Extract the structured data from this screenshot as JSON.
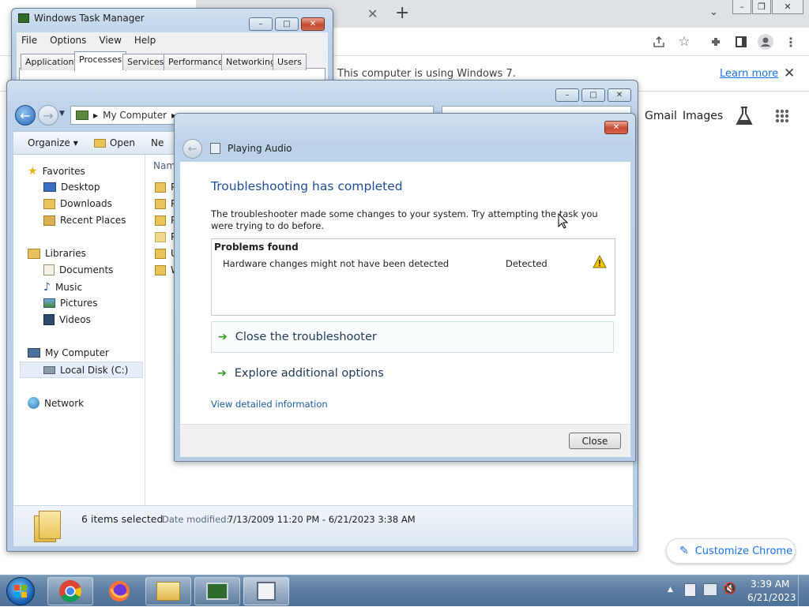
{
  "chrome": {
    "infobar_text": "This computer is using Windows 7.",
    "learn_more": "Learn more",
    "shortcuts": [
      "Gmail",
      "Images"
    ],
    "customize_label": "Customize Chrome"
  },
  "taskmgr": {
    "title": "Windows Task Manager",
    "menus": [
      "File",
      "Options",
      "View",
      "Help"
    ],
    "tabs": [
      "Applications",
      "Processes",
      "Services",
      "Performance",
      "Networking",
      "Users"
    ],
    "active_tab": "Processes"
  },
  "explorer": {
    "breadcrumb": [
      "My Computer"
    ],
    "commands": [
      "Organize",
      "Open",
      "Ne"
    ],
    "column_header": "Nam",
    "files": [
      "P",
      "P",
      "P",
      "P",
      "U",
      "W"
    ],
    "nav": {
      "favorites": {
        "label": "Favorites",
        "items": [
          "Desktop",
          "Downloads",
          "Recent Places"
        ]
      },
      "libraries": {
        "label": "Libraries",
        "items": [
          "Documents",
          "Music",
          "Pictures",
          "Videos"
        ]
      },
      "computer": {
        "label": "My Computer",
        "items": [
          "Local Disk (C:)"
        ]
      },
      "network": "Network"
    },
    "status": {
      "count": "6 items selected",
      "modified_label": "Date modified:",
      "modified_value": "7/13/2009 11:20 PM - 6/21/2023 3:38 AM"
    }
  },
  "troubleshooter": {
    "title": "Playing Audio",
    "heading": "Troubleshooting has completed",
    "description": "The troubleshooter made some changes to your system. Try attempting the task you were trying to do before.",
    "problems_header": "Problems found",
    "problems": [
      {
        "name": "Hardware changes might not have been detected",
        "status": "Detected"
      }
    ],
    "options": [
      "Close the troubleshooter",
      "Explore additional options"
    ],
    "detail_link": "View detailed information",
    "close_button": "Close"
  },
  "taskbar": {
    "time": "3:39 AM",
    "date": "6/21/2023"
  },
  "colors": {
    "accent_blue": "#1a73e8",
    "heading_blue": "#1e4e9b",
    "link_blue": "#1a5ea8",
    "warning_yellow": "#f5c400"
  }
}
